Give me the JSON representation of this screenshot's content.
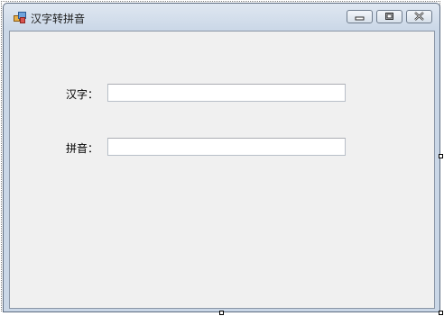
{
  "window": {
    "title": "汉字转拼音"
  },
  "form": {
    "hanzi_label": "汉字：",
    "hanzi_value": "",
    "pinyin_label": "拼音：",
    "pinyin_value": ""
  },
  "icons": {
    "app": "app-icon",
    "minimize": "minimize-icon",
    "maximize": "maximize-icon",
    "close": "close-icon"
  },
  "colors": {
    "client_background": "#f0f0f0",
    "titlebar": "#cad7e7"
  }
}
